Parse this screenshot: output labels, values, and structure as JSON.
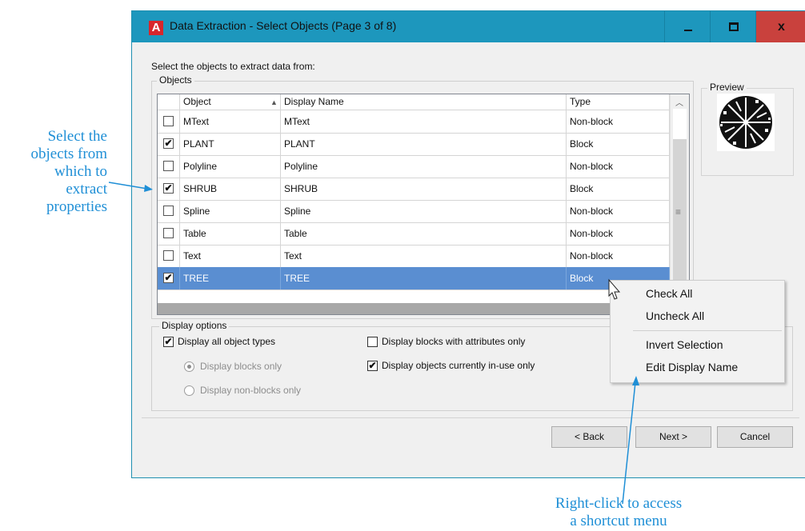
{
  "window": {
    "title": "Data Extraction - Select Objects (Page 3 of 8)",
    "app_icon_letter": "A",
    "controls": {
      "minimize": "minimize-icon",
      "maximize": "maximize-icon",
      "close": "x"
    }
  },
  "instruction": "Select the objects to extract data from:",
  "objects_group": {
    "title": "Objects",
    "columns": [
      "Object",
      "Display Name",
      "Type"
    ],
    "rows": [
      {
        "checked": false,
        "object": "MText",
        "display_name": "MText",
        "type": "Non-block"
      },
      {
        "checked": true,
        "object": "PLANT",
        "display_name": "PLANT",
        "type": "Block"
      },
      {
        "checked": false,
        "object": "Polyline",
        "display_name": "Polyline",
        "type": "Non-block"
      },
      {
        "checked": true,
        "object": "SHRUB",
        "display_name": "SHRUB",
        "type": "Block"
      },
      {
        "checked": false,
        "object": "Spline",
        "display_name": "Spline",
        "type": "Non-block"
      },
      {
        "checked": false,
        "object": "Table",
        "display_name": "Table",
        "type": "Non-block"
      },
      {
        "checked": false,
        "object": "Text",
        "display_name": "Text",
        "type": "Non-block"
      },
      {
        "checked": true,
        "object": "TREE",
        "display_name": "TREE",
        "type": "Block",
        "selected": true
      }
    ]
  },
  "preview": {
    "title": "Preview"
  },
  "display_options": {
    "title": "Display options",
    "display_all": {
      "label": "Display all object types",
      "checked": true
    },
    "blocks_only": {
      "label": "Display blocks only",
      "selected": true,
      "enabled": false
    },
    "non_blocks_only": {
      "label": "Display non-blocks only",
      "selected": false,
      "enabled": false
    },
    "blocks_with_attributes": {
      "label": "Display blocks with attributes only",
      "checked": false
    },
    "in_use_only": {
      "label": "Display objects currently in-use only",
      "checked": true
    }
  },
  "buttons": {
    "back": "< Back",
    "next": "Next >",
    "cancel": "Cancel"
  },
  "context_menu": {
    "items": [
      "Check All",
      "Uncheck All",
      "Invert Selection",
      "Edit Display Name"
    ]
  },
  "annotations": {
    "left": [
      "Select the",
      "objects from",
      "which to",
      "extract",
      "properties"
    ],
    "bottom": [
      "Right-click to access",
      "a shortcut menu"
    ]
  },
  "colors": {
    "titlebar": "#1d97bd",
    "close_button": "#c9413d",
    "selection": "#5a8ed1",
    "annotation": "#1f8fd6",
    "app_icon": "#d8262b"
  }
}
